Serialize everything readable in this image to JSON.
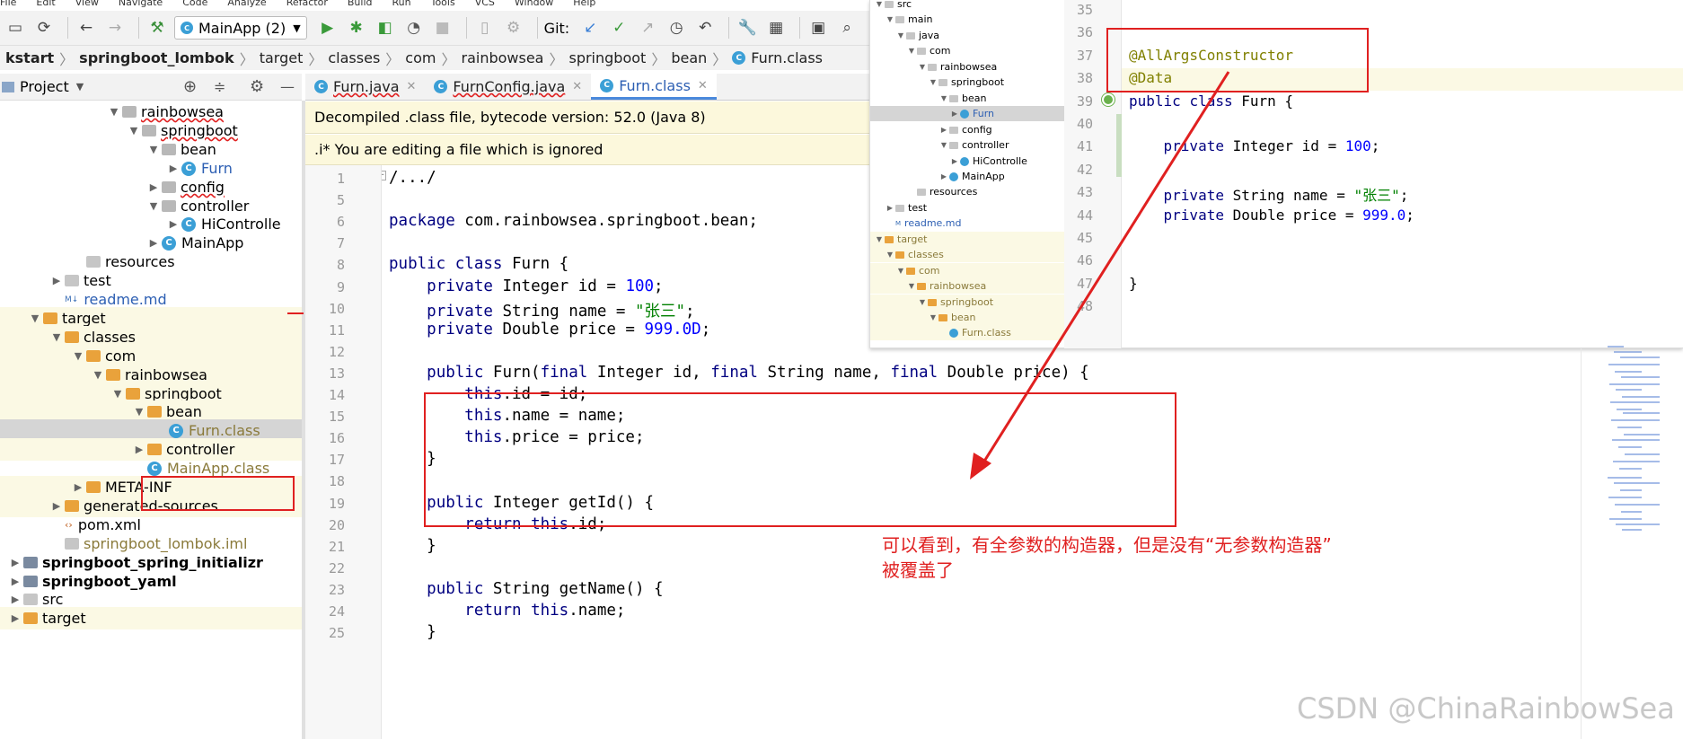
{
  "menubar": [
    "File",
    "Edit",
    "View",
    "Navigate",
    "Code",
    "Analyze",
    "Refactor",
    "Build",
    "Run",
    "Tools",
    "VCS",
    "Window",
    "Help"
  ],
  "toolbar": {
    "run_config": "MainApp (2)",
    "git_label": "Git:"
  },
  "breadcrumb": [
    "kstart",
    "springboot_lombok",
    "target",
    "classes",
    "com",
    "rainbowsea",
    "springboot",
    "bean",
    "Furn.class"
  ],
  "project_panel": {
    "title": "Project"
  },
  "tree": [
    {
      "label": "rainbowsea",
      "kind": "pkg",
      "indent": 118,
      "arrow": "▼"
    },
    {
      "label": "springboot",
      "kind": "pkg",
      "indent": 140,
      "arrow": "▼"
    },
    {
      "label": "bean",
      "kind": "pkg",
      "indent": 162,
      "arrow": "▼"
    },
    {
      "label": "Furn",
      "kind": "class",
      "indent": 184,
      "arrow": "▶"
    },
    {
      "label": "config",
      "kind": "pkg",
      "indent": 162,
      "arrow": "▶"
    },
    {
      "label": "controller",
      "kind": "pkg",
      "indent": 162,
      "arrow": "▼"
    },
    {
      "label": "HiControlle",
      "kind": "class",
      "indent": 184,
      "arrow": "▶"
    },
    {
      "label": "MainApp",
      "kind": "class",
      "indent": 162,
      "arrow": "▶"
    },
    {
      "label": "resources",
      "kind": "folder",
      "indent": 78,
      "arrow": ""
    },
    {
      "label": "test",
      "kind": "folder",
      "indent": 54,
      "arrow": "▶"
    },
    {
      "label": "readme.md",
      "kind": "md",
      "indent": 54,
      "arrow": ""
    },
    {
      "label": "target",
      "kind": "or",
      "indent": 30,
      "arrow": "▼"
    },
    {
      "label": "classes",
      "kind": "or",
      "indent": 54,
      "arrow": "▼"
    },
    {
      "label": "com",
      "kind": "or",
      "indent": 78,
      "arrow": "▼"
    },
    {
      "label": "rainbowsea",
      "kind": "or",
      "indent": 100,
      "arrow": "▼"
    },
    {
      "label": "springboot",
      "kind": "or",
      "indent": 122,
      "arrow": "▼"
    },
    {
      "label": "bean",
      "kind": "or",
      "indent": 146,
      "arrow": "▼"
    },
    {
      "label": "Furn.class",
      "kind": "classfile",
      "indent": 170,
      "arrow": ""
    },
    {
      "label": "controller",
      "kind": "or",
      "indent": 146,
      "arrow": "▶"
    },
    {
      "label": "MainApp.class",
      "kind": "classfile",
      "indent": 146,
      "arrow": ""
    },
    {
      "label": "META-INF",
      "kind": "or",
      "indent": 78,
      "arrow": "▶"
    },
    {
      "label": "generated-sources",
      "kind": "or",
      "indent": 54,
      "arrow": "▶"
    },
    {
      "label": "pom.xml",
      "kind": "xml",
      "indent": 54,
      "arrow": ""
    },
    {
      "label": "springboot_lombok.iml",
      "kind": "iml",
      "indent": 54,
      "arrow": ""
    },
    {
      "label": "springboot_spring_initializr",
      "kind": "module",
      "indent": 8,
      "arrow": "▶"
    },
    {
      "label": "springboot_yaml",
      "kind": "module",
      "indent": 8,
      "arrow": "▶"
    },
    {
      "label": "src",
      "kind": "folder",
      "indent": 8,
      "arrow": "▶"
    },
    {
      "label": "target",
      "kind": "or",
      "indent": 8,
      "arrow": "▶"
    }
  ],
  "tabs": [
    {
      "label": "Furn.java",
      "active": false
    },
    {
      "label": "FurnConfig.java",
      "active": false
    },
    {
      "label": "Furn.class",
      "active": true
    }
  ],
  "banners": {
    "decompiled": "Decompiled .class file, bytecode version: 52.0 (Java 8)",
    "ignored": ".i* You are editing a file which is ignored"
  },
  "code_lines": [
    {
      "n": "1",
      "text": "/.../"
    },
    {
      "n": "5",
      "text": ""
    },
    {
      "n": "6",
      "text": "package com.rainbowsea.springboot.bean;"
    },
    {
      "n": "7",
      "text": ""
    },
    {
      "n": "8",
      "text": "public class Furn {"
    },
    {
      "n": "9",
      "text": "    private Integer id = 100;"
    },
    {
      "n": "10",
      "text": "    private String name = \"张三\";"
    },
    {
      "n": "11",
      "text": "    private Double price = 999.0D;"
    },
    {
      "n": "12",
      "text": ""
    },
    {
      "n": "13",
      "text": "    public Furn(final Integer id, final String name, final Double price) {"
    },
    {
      "n": "14",
      "text": "        this.id = id;"
    },
    {
      "n": "15",
      "text": "        this.name = name;"
    },
    {
      "n": "16",
      "text": "        this.price = price;"
    },
    {
      "n": "17",
      "text": "    }"
    },
    {
      "n": "18",
      "text": ""
    },
    {
      "n": "19",
      "text": "    public Integer getId() {"
    },
    {
      "n": "20",
      "text": "        return this.id;"
    },
    {
      "n": "21",
      "text": "    }"
    },
    {
      "n": "22",
      "text": ""
    },
    {
      "n": "23",
      "text": "    public String getName() {"
    },
    {
      "n": "24",
      "text": "        return this.name;"
    },
    {
      "n": "25",
      "text": "    }"
    }
  ],
  "overlay": {
    "tree": [
      {
        "label": "src",
        "indent": 4,
        "arrow": "▼",
        "kind": "folder"
      },
      {
        "label": "main",
        "indent": 16,
        "arrow": "▼",
        "kind": "folder"
      },
      {
        "label": "java",
        "indent": 28,
        "arrow": "▼",
        "kind": "folder"
      },
      {
        "label": "com",
        "indent": 40,
        "arrow": "▼",
        "kind": "pkg"
      },
      {
        "label": "rainbowsea",
        "indent": 52,
        "arrow": "▼",
        "kind": "pkg"
      },
      {
        "label": "springboot",
        "indent": 64,
        "arrow": "▼",
        "kind": "pkg"
      },
      {
        "label": "bean",
        "indent": 76,
        "arrow": "▼",
        "kind": "pkg"
      },
      {
        "label": "Furn",
        "indent": 88,
        "arrow": "▶",
        "kind": "class"
      },
      {
        "label": "config",
        "indent": 76,
        "arrow": "▶",
        "kind": "pkg"
      },
      {
        "label": "controller",
        "indent": 76,
        "arrow": "▼",
        "kind": "pkg"
      },
      {
        "label": "HiControlle",
        "indent": 88,
        "arrow": "▶",
        "kind": "class"
      },
      {
        "label": "MainApp",
        "indent": 76,
        "arrow": "▶",
        "kind": "class"
      },
      {
        "label": "resources",
        "indent": 40,
        "arrow": "",
        "kind": "folder"
      },
      {
        "label": "test",
        "indent": 16,
        "arrow": "▶",
        "kind": "folder"
      },
      {
        "label": "readme.md",
        "indent": 16,
        "arrow": "",
        "kind": "md"
      },
      {
        "label": "target",
        "indent": 4,
        "arrow": "▼",
        "kind": "or"
      },
      {
        "label": "classes",
        "indent": 16,
        "arrow": "▼",
        "kind": "or"
      },
      {
        "label": "com",
        "indent": 28,
        "arrow": "▼",
        "kind": "or"
      },
      {
        "label": "rainbowsea",
        "indent": 40,
        "arrow": "▼",
        "kind": "or"
      },
      {
        "label": "springboot",
        "indent": 52,
        "arrow": "▼",
        "kind": "or"
      },
      {
        "label": "bean",
        "indent": 64,
        "arrow": "▼",
        "kind": "or"
      },
      {
        "label": "Furn.class",
        "indent": 76,
        "arrow": "",
        "kind": "classfile"
      }
    ],
    "line_numbers": [
      "35",
      "36",
      "37",
      "38",
      "39",
      "40",
      "41",
      "42",
      "43",
      "44",
      "45",
      "46",
      "47",
      "48"
    ],
    "code_lines": [
      {
        "text": ""
      },
      {
        "text": ""
      },
      {
        "text": "@AllArgsConstructor"
      },
      {
        "text": "@Data"
      },
      {
        "text": "public class Furn {"
      },
      {
        "text": ""
      },
      {
        "text": "    private Integer id = 100;"
      },
      {
        "text": ""
      },
      {
        "text": "    private String name = \"张三\";"
      },
      {
        "text": "    private Double price = 999.0;"
      },
      {
        "text": ""
      },
      {
        "text": ""
      },
      {
        "text": "}"
      },
      {
        "text": ""
      }
    ]
  },
  "annotation": {
    "line1": "可以看到，有全参数的构造器，但是没有“无参数构造器”",
    "line2": "被覆盖了"
  },
  "watermark": "CSDN @ChinaRainbowSea",
  "colors": {
    "annotation_red": "#e02020",
    "banner_yellow": "#fcf8dc",
    "target_highlight": "#fbf9e4",
    "keyword": "#000080"
  }
}
